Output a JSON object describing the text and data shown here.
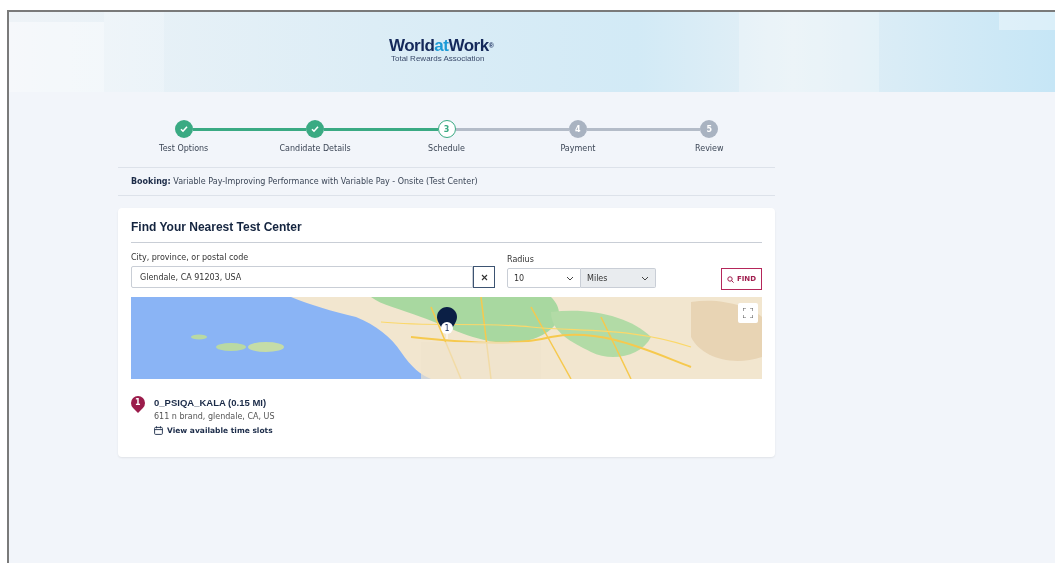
{
  "header": {
    "logo": {
      "parts": [
        {
          "text": "World",
          "kind": "dark"
        },
        {
          "text": "at",
          "kind": "accent"
        },
        {
          "text": "Work",
          "kind": "dark"
        }
      ],
      "mark": "®",
      "tagline": "Total Rewards Association"
    }
  },
  "steps": [
    {
      "label": "Test Options",
      "completed": true,
      "current": false
    },
    {
      "label": "Candidate Details",
      "completed": true,
      "current": false
    },
    {
      "number": "3",
      "label": "Schedule",
      "completed": false,
      "current": true
    },
    {
      "number": "4",
      "label": "Payment",
      "completed": false,
      "current": false
    },
    {
      "number": "5",
      "label": "Review",
      "completed": false,
      "current": false
    }
  ],
  "booking": "**Booking:** Variable Pay-Improving Performance with Variable Pay - Onsite (Test Center)",
  "finder": {
    "title": "Find Your Nearest Test Center",
    "location": {
      "label": "City, province, or postal code",
      "value": "Glendale, CA 91203, USA"
    },
    "radius": {
      "label": "Radius",
      "distance": "10",
      "unit": "Miles"
    },
    "find_button": "FIND",
    "map": {
      "kind": "picture",
      "marker": "1"
    },
    "results": [
      {
        "marker": "1",
        "name": "0_PSIQA_KALA (0.15 MI)",
        "address": "611 n brand, glendale, CA, US",
        "link": "View available time slots"
      }
    ]
  }
}
